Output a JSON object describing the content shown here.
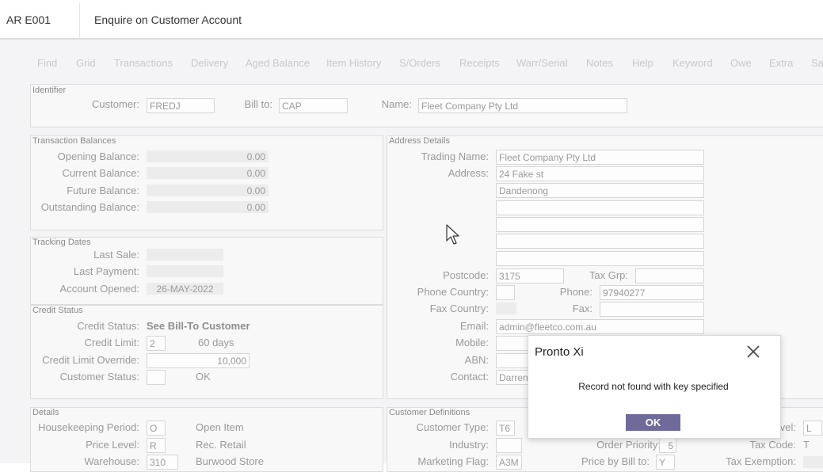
{
  "header": {
    "program_code": "AR E001",
    "title": "Enquire on Customer Account"
  },
  "toolbar": [
    "Find",
    "Grid",
    "Transactions",
    "Delivery",
    "Aged Balance",
    "Item History",
    "S/Orders",
    "Receipts",
    "Warr/Serial",
    "Notes",
    "Help",
    "Keyword",
    "Owe",
    "Extra",
    "Sa"
  ],
  "identifier": {
    "title": "Identifier",
    "customer_label": "Customer:",
    "customer_value": "FREDJ",
    "billto_label": "Bill to:",
    "billto_value": "CAP",
    "name_label": "Name:",
    "name_value": "Fleet Company Pty Ltd"
  },
  "balances": {
    "title": "Transaction Balances",
    "rows": [
      {
        "label": "Opening Balance:",
        "value": "0.00"
      },
      {
        "label": "Current Balance:",
        "value": "0.00"
      },
      {
        "label": "Future Balance:",
        "value": "0.00"
      },
      {
        "label": "Outstanding Balance:",
        "value": "0.00"
      }
    ]
  },
  "tracking": {
    "title": "Tracking Dates",
    "last_sale_label": "Last Sale:",
    "last_sale_value": "",
    "last_payment_label": "Last Payment:",
    "last_payment_value": "",
    "opened_label": "Account Opened:",
    "opened_value": "26-MAY-2022"
  },
  "credit": {
    "title": "Credit Status",
    "status_label": "Credit Status:",
    "status_value": "See Bill-To Customer",
    "limit_label": "Credit Limit:",
    "limit_value": "2",
    "limit_days": "60 days",
    "override_label": "Credit Limit Override:",
    "override_value": "10,000",
    "cust_status_label": "Customer Status:",
    "cust_status_value": "",
    "cust_status_text": "OK"
  },
  "address": {
    "title": "Address Details",
    "trading_label": "Trading Name:",
    "trading_value": "Fleet Company Pty Ltd",
    "address_label": "Address:",
    "lines": [
      "24 Fake st",
      "Dandenong",
      "",
      "",
      "",
      ""
    ],
    "postcode_label": "Postcode:",
    "postcode_value": "3175",
    "taxgrp_label": "Tax Grp:",
    "taxgrp_value": "",
    "phone_country_label": "Phone Country:",
    "phone_country_value": "",
    "phone_label": "Phone:",
    "phone_value": "97940277",
    "fax_country_label": "Fax Country:",
    "fax_label": "Fax:",
    "fax_value": "",
    "email_label": "Email:",
    "email_value": "admin@fleetco.com.au",
    "mobile_label": "Mobile:",
    "mobile_value": "",
    "abn_label": "ABN:",
    "abn_value": "",
    "contact_label": "Contact:",
    "contact_value": "Darren"
  },
  "details": {
    "title": "Details",
    "hk_label": "Housekeeping Period:",
    "hk_value": "O",
    "hk_text": "Open Item",
    "price_label": "Price Level:",
    "price_value": "R",
    "price_text": "Rec. Retail",
    "wh_label": "Warehouse:",
    "wh_value": "310",
    "wh_text": "Burwood Store"
  },
  "custdef": {
    "title": "Customer Definitions",
    "type_label": "Customer Type:",
    "type_value": "T6",
    "industry_label": "Industry:",
    "industry_value": "",
    "order_priority_label": "Order Priority:",
    "order_priority_value": "5",
    "marketing_label": "Marketing Flag:",
    "marketing_value": "A3M",
    "price_billto_label": "Price by Bill to:",
    "price_billto_value": "Y",
    "level_label": "evel:",
    "level_value": "L",
    "taxcode_label": "Tax Code:",
    "taxcode_value": "T",
    "taxexempt_label": "Tax Exemption:"
  },
  "dialog": {
    "title": "Pronto Xi",
    "message": "Record not found with key specified",
    "ok_label": "OK"
  }
}
